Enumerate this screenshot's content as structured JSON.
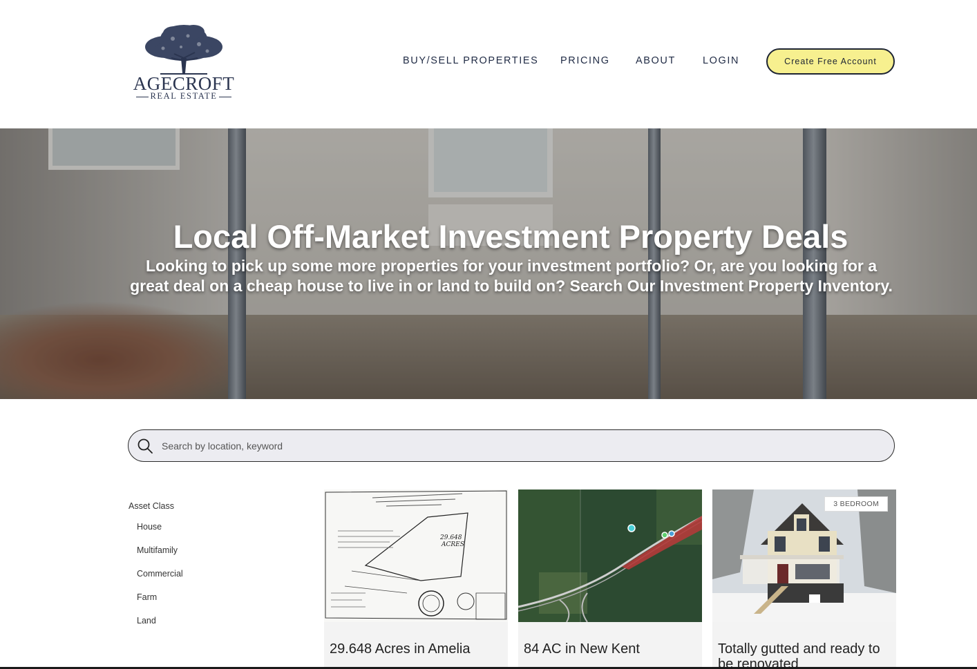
{
  "brand": {
    "name": "AGECROFT",
    "tagline": "REAL ESTATE"
  },
  "nav": {
    "items": [
      "BUY/SELL PROPERTIES",
      "PRICING",
      "ABOUT",
      "LOGIN"
    ],
    "cta_label": "Create Free Account"
  },
  "hero": {
    "title": "Local Off-Market Investment Property Deals",
    "subtitle": "Looking to pick up some more properties for your investment portfolio? Or, are you looking for a great deal on a cheap house to live in or land to build on? Search Our Investment Property Inventory."
  },
  "search": {
    "placeholder": "Search by location, keyword",
    "value": ""
  },
  "filters": {
    "title": "Asset Class",
    "items": [
      "House",
      "Multifamily",
      "Commercial",
      "Farm",
      "Land"
    ]
  },
  "listings": [
    {
      "title": "29.648 Acres in Amelia",
      "badge": ""
    },
    {
      "title": "84 AC in New Kent",
      "badge": ""
    },
    {
      "title": "Totally gutted and ready to be renovated",
      "badge": "3 BEDROOM"
    }
  ],
  "colors": {
    "cta_background": "#f7f08f",
    "nav_text": "#1f2a44",
    "search_background": "#ececf1"
  }
}
